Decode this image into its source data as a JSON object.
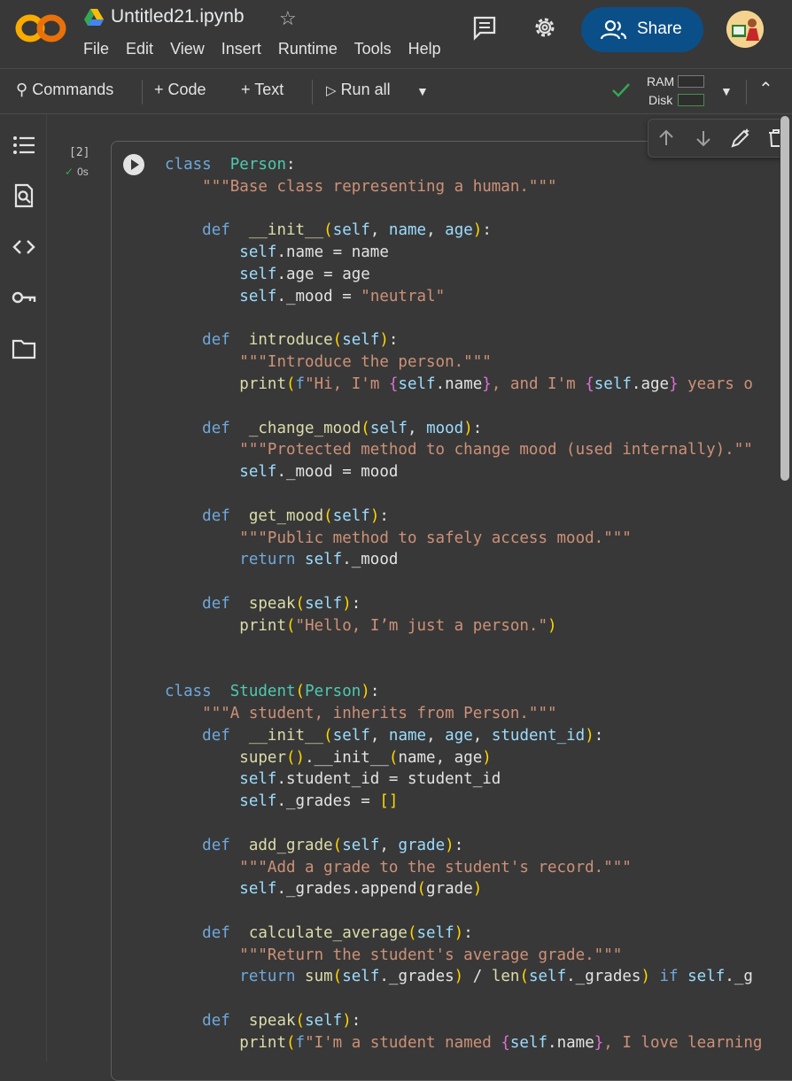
{
  "header": {
    "notebook_title": "Untitled21.ipynb",
    "menu": [
      "File",
      "Edit",
      "View",
      "Insert",
      "Runtime",
      "Tools",
      "Help"
    ],
    "share_label": "Share"
  },
  "toolbar": {
    "commands_label": "Commands",
    "code_label": "Code",
    "text_label": "Text",
    "run_all_label": "Run all",
    "ram_label": "RAM",
    "disk_label": "Disk"
  },
  "cell": {
    "exec_count": "[2]",
    "exec_time": "0s"
  },
  "colors": {
    "accent": "#0b4f88",
    "ok": "#34a853",
    "background": "#383838"
  },
  "sidebar_icons": [
    "table-of-contents-icon",
    "find-icon",
    "code-snippets-icon",
    "secrets-key-icon",
    "files-folder-icon"
  ],
  "code_lines": [
    [
      [
        "kw",
        "class"
      ],
      [
        "",
        "  "
      ],
      [
        "cn",
        "Person"
      ],
      [
        "",
        ":"
      ]
    ],
    [
      [
        "",
        "    "
      ],
      [
        "st",
        "\"\"\"Base class representing a human.\"\"\""
      ]
    ],
    [],
    [
      [
        "",
        "    "
      ],
      [
        "kw",
        "def"
      ],
      [
        "",
        "  "
      ],
      [
        "fn",
        "__init__"
      ],
      [
        "p1",
        "("
      ],
      [
        "sf",
        "self"
      ],
      [
        "",
        ", "
      ],
      [
        "sf",
        "name"
      ],
      [
        "",
        ", "
      ],
      [
        "sf",
        "age"
      ],
      [
        "p1",
        ")"
      ],
      [
        "",
        ":"
      ]
    ],
    [
      [
        "",
        "        "
      ],
      [
        "sf",
        "self"
      ],
      [
        "",
        ".name = name"
      ]
    ],
    [
      [
        "",
        "        "
      ],
      [
        "sf",
        "self"
      ],
      [
        "",
        ".age = age"
      ]
    ],
    [
      [
        "",
        "        "
      ],
      [
        "sf",
        "self"
      ],
      [
        "",
        "._mood = "
      ],
      [
        "st",
        "\"neutral\""
      ]
    ],
    [],
    [
      [
        "",
        "    "
      ],
      [
        "kw",
        "def"
      ],
      [
        "",
        "  "
      ],
      [
        "fn",
        "introduce"
      ],
      [
        "p1",
        "("
      ],
      [
        "sf",
        "self"
      ],
      [
        "p1",
        ")"
      ],
      [
        "",
        ":"
      ]
    ],
    [
      [
        "",
        "        "
      ],
      [
        "st",
        "\"\"\"Introduce the person.\"\"\""
      ]
    ],
    [
      [
        "",
        "        "
      ],
      [
        "bi",
        "print"
      ],
      [
        "p1",
        "("
      ],
      [
        "kw",
        "f"
      ],
      [
        "st",
        "\"Hi, I'm "
      ],
      [
        "p2",
        "{"
      ],
      [
        "sf",
        "self"
      ],
      [
        "",
        ".name"
      ],
      [
        "p2",
        "}"
      ],
      [
        "st",
        ", and I'm "
      ],
      [
        "p2",
        "{"
      ],
      [
        "sf",
        "self"
      ],
      [
        "",
        ".age"
      ],
      [
        "p2",
        "}"
      ],
      [
        "st",
        " years o"
      ]
    ],
    [],
    [
      [
        "",
        "    "
      ],
      [
        "kw",
        "def"
      ],
      [
        "",
        "  "
      ],
      [
        "fn",
        "_change_mood"
      ],
      [
        "p1",
        "("
      ],
      [
        "sf",
        "self"
      ],
      [
        "",
        ", "
      ],
      [
        "sf",
        "mood"
      ],
      [
        "p1",
        ")"
      ],
      [
        "",
        ":"
      ]
    ],
    [
      [
        "",
        "        "
      ],
      [
        "st",
        "\"\"\"Protected method to change mood (used internally).\"\""
      ]
    ],
    [
      [
        "",
        "        "
      ],
      [
        "sf",
        "self"
      ],
      [
        "",
        "._mood = mood"
      ]
    ],
    [],
    [
      [
        "",
        "    "
      ],
      [
        "kw",
        "def"
      ],
      [
        "",
        "  "
      ],
      [
        "fn",
        "get_mood"
      ],
      [
        "p1",
        "("
      ],
      [
        "sf",
        "self"
      ],
      [
        "p1",
        ")"
      ],
      [
        "",
        ":"
      ]
    ],
    [
      [
        "",
        "        "
      ],
      [
        "st",
        "\"\"\"Public method to safely access mood.\"\"\""
      ]
    ],
    [
      [
        "",
        "        "
      ],
      [
        "kw",
        "return"
      ],
      [
        "",
        ""
      ],
      [
        "sf",
        " self"
      ],
      [
        "",
        "._mood"
      ]
    ],
    [],
    [
      [
        "",
        "    "
      ],
      [
        "kw",
        "def"
      ],
      [
        "",
        "  "
      ],
      [
        "fn",
        "speak"
      ],
      [
        "p1",
        "("
      ],
      [
        "sf",
        "self"
      ],
      [
        "p1",
        ")"
      ],
      [
        "",
        ":"
      ]
    ],
    [
      [
        "",
        "        "
      ],
      [
        "bi",
        "print"
      ],
      [
        "p1",
        "("
      ],
      [
        "st",
        "\"Hello, I’m just a person.\""
      ],
      [
        "p1",
        ")"
      ]
    ],
    [],
    [],
    [
      [
        "kw",
        "class"
      ],
      [
        "",
        "  "
      ],
      [
        "cn",
        "Student"
      ],
      [
        "p1",
        "("
      ],
      [
        "cn",
        "Person"
      ],
      [
        "p1",
        ")"
      ],
      [
        "",
        ":"
      ]
    ],
    [
      [
        "",
        "    "
      ],
      [
        "st",
        "\"\"\"A student, inherits from Person.\"\"\""
      ]
    ],
    [
      [
        "",
        "    "
      ],
      [
        "kw",
        "def"
      ],
      [
        "",
        "  "
      ],
      [
        "fn",
        "__init__"
      ],
      [
        "p1",
        "("
      ],
      [
        "sf",
        "self"
      ],
      [
        "",
        ", "
      ],
      [
        "sf",
        "name"
      ],
      [
        "",
        ", "
      ],
      [
        "sf",
        "age"
      ],
      [
        "",
        ", "
      ],
      [
        "sf",
        "student_id"
      ],
      [
        "p1",
        ")"
      ],
      [
        "",
        ":"
      ]
    ],
    [
      [
        "",
        "        "
      ],
      [
        "bi",
        "super"
      ],
      [
        "p1",
        "()"
      ],
      [
        "",
        ".__init__"
      ],
      [
        "p1",
        "("
      ],
      [
        "",
        "name, age"
      ],
      [
        "p1",
        ")"
      ]
    ],
    [
      [
        "",
        "        "
      ],
      [
        "sf",
        "self"
      ],
      [
        "",
        ".student_id = student_id"
      ]
    ],
    [
      [
        "",
        "        "
      ],
      [
        "sf",
        "self"
      ],
      [
        "",
        "._grades = "
      ],
      [
        "p1",
        "[]"
      ]
    ],
    [],
    [
      [
        "",
        "    "
      ],
      [
        "kw",
        "def"
      ],
      [
        "",
        "  "
      ],
      [
        "fn",
        "add_grade"
      ],
      [
        "p1",
        "("
      ],
      [
        "sf",
        "self"
      ],
      [
        "",
        ", "
      ],
      [
        "sf",
        "grade"
      ],
      [
        "p1",
        ")"
      ],
      [
        "",
        ":"
      ]
    ],
    [
      [
        "",
        "        "
      ],
      [
        "st",
        "\"\"\"Add a grade to the student's record.\"\"\""
      ]
    ],
    [
      [
        "",
        "        "
      ],
      [
        "sf",
        "self"
      ],
      [
        "",
        "._grades.append"
      ],
      [
        "p1",
        "("
      ],
      [
        "",
        "grade"
      ],
      [
        "p1",
        ")"
      ]
    ],
    [],
    [
      [
        "",
        "    "
      ],
      [
        "kw",
        "def"
      ],
      [
        "",
        "  "
      ],
      [
        "fn",
        "calculate_average"
      ],
      [
        "p1",
        "("
      ],
      [
        "sf",
        "self"
      ],
      [
        "p1",
        ")"
      ],
      [
        "",
        ":"
      ]
    ],
    [
      [
        "",
        "        "
      ],
      [
        "st",
        "\"\"\"Return the student's average grade.\"\"\""
      ]
    ],
    [
      [
        "",
        "        "
      ],
      [
        "kw",
        "return"
      ],
      [
        "bi",
        " sum"
      ],
      [
        "p1",
        "("
      ],
      [
        "sf",
        "self"
      ],
      [
        "",
        "._grades"
      ],
      [
        "p1",
        ")"
      ],
      [
        "",
        " / "
      ],
      [
        "bi",
        "len"
      ],
      [
        "p1",
        "("
      ],
      [
        "sf",
        "self"
      ],
      [
        "",
        "._grades"
      ],
      [
        "p1",
        ")"
      ],
      [
        "kw",
        " if"
      ],
      [
        "sf",
        " self"
      ],
      [
        "",
        "._g"
      ]
    ],
    [],
    [
      [
        "",
        "    "
      ],
      [
        "kw",
        "def"
      ],
      [
        "",
        "  "
      ],
      [
        "fn",
        "speak"
      ],
      [
        "p1",
        "("
      ],
      [
        "sf",
        "self"
      ],
      [
        "p1",
        ")"
      ],
      [
        "",
        ":"
      ]
    ],
    [
      [
        "",
        "        "
      ],
      [
        "bi",
        "print"
      ],
      [
        "p1",
        "("
      ],
      [
        "kw",
        "f"
      ],
      [
        "st",
        "\"I'm a student named "
      ],
      [
        "p2",
        "{"
      ],
      [
        "sf",
        "self"
      ],
      [
        "",
        ".name"
      ],
      [
        "p2",
        "}"
      ],
      [
        "st",
        ", I love learning"
      ]
    ]
  ]
}
